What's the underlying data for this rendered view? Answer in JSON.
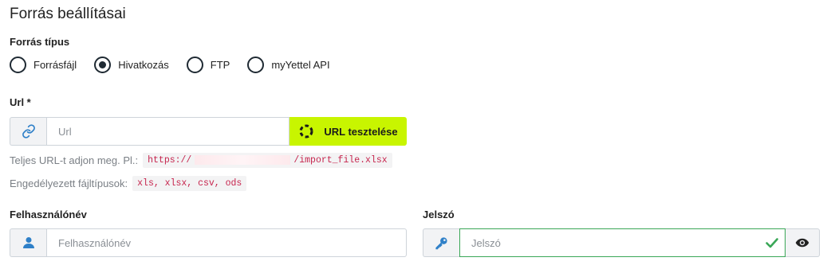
{
  "section_title": "Forrás beállításai",
  "source_type": {
    "label": "Forrás típus",
    "options": [
      {
        "label": "Forrásfájl",
        "selected": false
      },
      {
        "label": "Hivatkozás",
        "selected": true
      },
      {
        "label": "FTP",
        "selected": false
      },
      {
        "label": "myYettel API",
        "selected": false
      }
    ]
  },
  "url": {
    "label": "Url *",
    "placeholder": "Url",
    "value": "",
    "test_button": "URL tesztelése",
    "help_prefix": "Teljes URL-t adjon meg. Pl.:",
    "example_start": "https://",
    "example_end": "/import_file.xlsx",
    "types_prefix": "Engedélyezett fájltípusok:",
    "types": "xls, xlsx, csv, ods"
  },
  "username": {
    "label": "Felhasználónév",
    "placeholder": "Felhasználónév",
    "value": ""
  },
  "password": {
    "label": "Jelszó",
    "placeholder": "Jelszó",
    "value": ""
  },
  "colors": {
    "accent": "#c8f500",
    "icon_blue": "#2f80c8",
    "valid_green": "#3aa757"
  }
}
